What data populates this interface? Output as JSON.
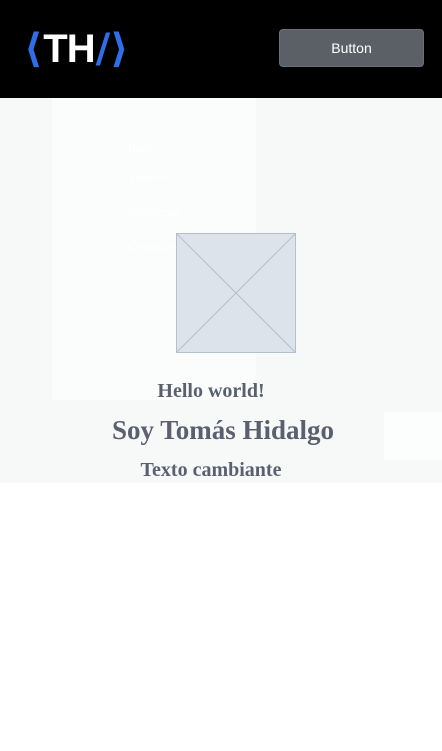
{
  "navbar": {
    "logo": {
      "open": "⟨",
      "letters": "TH",
      "close": "/⟩"
    },
    "button_label": "Button"
  },
  "menu": {
    "items": [
      "Inicio",
      "Sobre mí",
      "Proyectos",
      "Contacto"
    ]
  },
  "hero": {
    "greeting": "Hello world!",
    "name": "Soy Tomás Hidalgo",
    "changing_text": "Texto cambiante"
  },
  "colors": {
    "navbar_bg": "#000000",
    "logo_accent": "#2f6ee6",
    "button_bg": "#5b6067",
    "hero_bg": "#f7f9f9",
    "hero_text": "#5a6070"
  }
}
